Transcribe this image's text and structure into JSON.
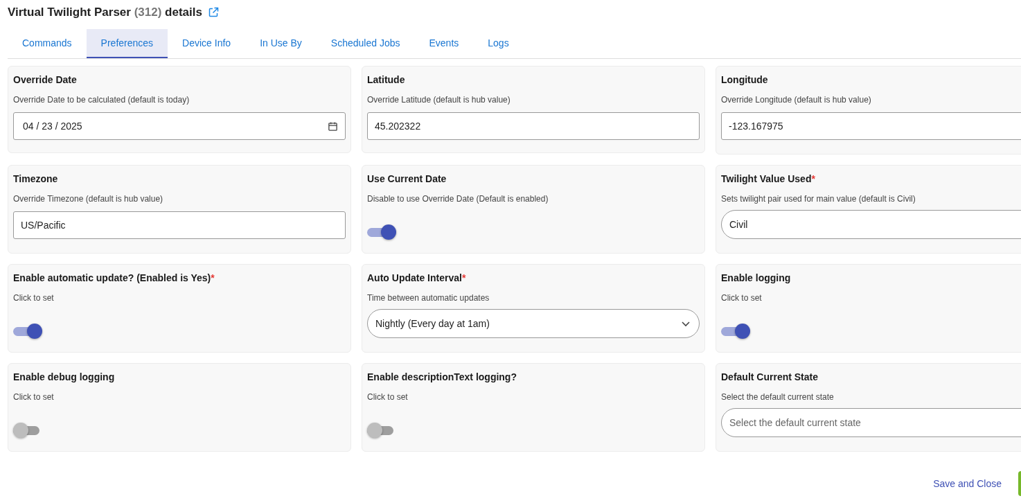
{
  "header": {
    "name": "Virtual Twilight Parser",
    "count": "(312)",
    "suffix": "details"
  },
  "tabs": [
    {
      "label": "Commands",
      "selected": false
    },
    {
      "label": "Preferences",
      "selected": true
    },
    {
      "label": "Device Info",
      "selected": false
    },
    {
      "label": "In Use By",
      "selected": false
    },
    {
      "label": "Scheduled Jobs",
      "selected": false
    },
    {
      "label": "Events",
      "selected": false
    },
    {
      "label": "Logs",
      "selected": false
    }
  ],
  "preferences": [
    {
      "kind": "date",
      "title": "Override Date",
      "description": "Override Date to be calculated (default is today)",
      "value": "04 / 23 / 2025"
    },
    {
      "kind": "text",
      "title": "Latitude",
      "description": "Override Latitude (default is hub value)",
      "value": "45.202322"
    },
    {
      "kind": "text",
      "title": "Longitude",
      "description": "Override Longitude (default is hub value)",
      "value": "-123.167975"
    },
    {
      "kind": "text",
      "title": "Timezone",
      "description": "Override Timezone (default is hub value)",
      "value": "US/Pacific"
    },
    {
      "kind": "toggle",
      "title": "Use Current Date",
      "description": "Disable to use Override Date (Default is enabled)",
      "on": true
    },
    {
      "kind": "select",
      "title": "Twilight Value Used",
      "required_mark": "*",
      "description": "Sets twilight pair used for main value (default is Civil)",
      "value": "Civil"
    },
    {
      "kind": "toggle",
      "title": "Enable automatic update? (Enabled is Yes)",
      "required_mark": "*",
      "description": "Click to set",
      "on": true
    },
    {
      "kind": "select",
      "title": "Auto Update Interval",
      "required_mark": "*",
      "description": "Time between automatic updates",
      "value": "Nightly (Every day at 1am)"
    },
    {
      "kind": "toggle",
      "title": "Enable logging",
      "description": "Click to set",
      "on": true
    },
    {
      "kind": "toggle",
      "title": "Enable debug logging",
      "description": "Click to set",
      "on": false
    },
    {
      "kind": "toggle",
      "title": "Enable descriptionText logging?",
      "description": "Click to set",
      "on": false
    },
    {
      "kind": "select",
      "title": "Default Current State",
      "description": "Select the default current state",
      "placeholder": "Select the default current state"
    }
  ],
  "footer": {
    "save_label": "Save and Close"
  }
}
